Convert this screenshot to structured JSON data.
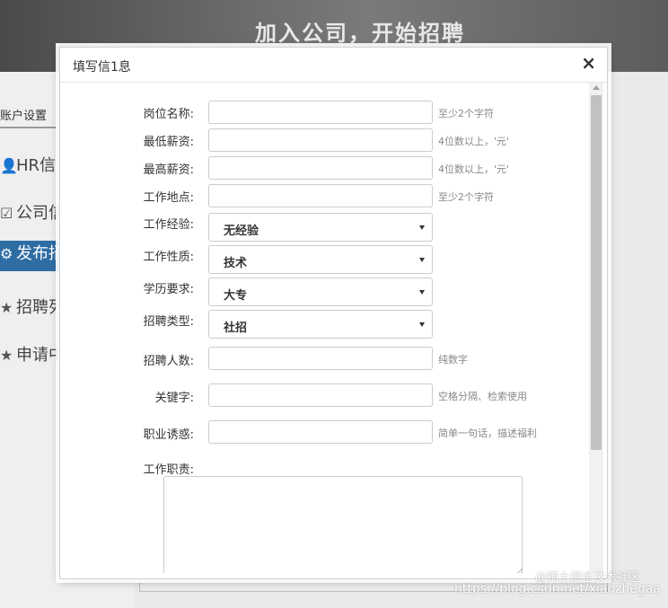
{
  "banner": {
    "text": "加入公司，开始招聘"
  },
  "sidebar": {
    "account_tab": "账户设置",
    "items": [
      {
        "label": "HR信",
        "icon": "user-icon"
      },
      {
        "label": "公司信",
        "icon": "checklist-icon"
      },
      {
        "label": "发布招",
        "icon": "gear-icon",
        "active": true
      },
      {
        "label": "招聘列",
        "icon": "user-star-icon"
      },
      {
        "label": "申请中",
        "icon": "star-icon"
      }
    ]
  },
  "modal": {
    "title": "填写信1息",
    "close_label": "×",
    "fields": {
      "position_name": {
        "label": "岗位名称:",
        "value": "",
        "hint": "至少2个字符"
      },
      "min_salary": {
        "label": "最低薪资:",
        "value": "",
        "hint": "4位数以上，'元'"
      },
      "max_salary": {
        "label": "最高薪资:",
        "value": "",
        "hint": "4位数以上，'元'"
      },
      "location": {
        "label": "工作地点:",
        "value": "",
        "hint": "至少2个字符"
      },
      "experience": {
        "label": "工作经验:",
        "selected": "无经验"
      },
      "job_nature": {
        "label": "工作性质:",
        "selected": "技术"
      },
      "education": {
        "label": "学历要求:",
        "selected": "大专"
      },
      "recruit_type": {
        "label": "招聘类型:",
        "selected": "社招"
      },
      "headcount": {
        "label": "招聘人数:",
        "value": "",
        "hint": "纯数字"
      },
      "keywords": {
        "label": "关键字:",
        "value": "",
        "hint": "空格分隔、检索使用"
      },
      "attraction": {
        "label": "职业诱惑:",
        "value": "",
        "hint": "简单一句话，描述福利"
      },
      "duties": {
        "label": "工作职责:",
        "value": ""
      }
    }
  },
  "watermark": {
    "line1": "@稀土掘金技术社区",
    "line2": "https://blog.csdn.net/xiaozhegaa"
  }
}
